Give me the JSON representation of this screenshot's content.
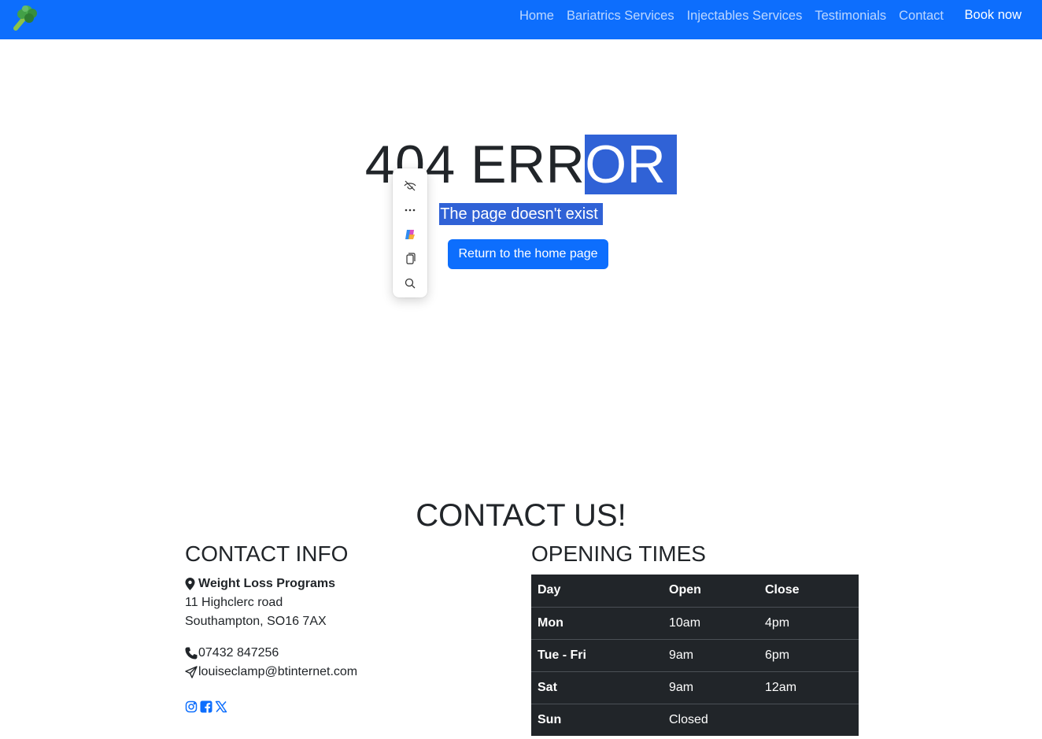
{
  "nav": {
    "logo_icon": "broccoli-icon",
    "links": [
      "Home",
      "Bariatrics Services",
      "Injectables Services",
      "Testimonials",
      "Contact"
    ],
    "book_label": "Book now",
    "bg_color": "#0d6efd"
  },
  "error": {
    "title_plain": "404 ERR",
    "title_selected": "OR",
    "subtitle": "The page doesn't exist",
    "home_button": "Return to the home page",
    "selection_color": "#3062d6"
  },
  "float_toolbar": {
    "icons": [
      "hide-icon",
      "more-icon",
      "copilot-icon",
      "copy-icon",
      "search-icon"
    ]
  },
  "contact": {
    "heading": "CONTACT US!",
    "info_title": "CONTACT INFO",
    "business_name": "Weight Loss Programs",
    "address_line1": "11 Highclerc road",
    "address_line2": "Southampton, SO16 7AX",
    "phone": "07432 847256",
    "email": "louiseclamp@btinternet.com",
    "social_icons": [
      "instagram-icon",
      "facebook-icon",
      "x-twitter-icon"
    ]
  },
  "hours": {
    "title": "OPENING TIMES",
    "headers": [
      "Day",
      "Open",
      "Close"
    ],
    "rows": [
      [
        "Mon",
        "10am",
        "4pm"
      ],
      [
        "Tue - Fri",
        "9am",
        "6pm"
      ],
      [
        "Sat",
        "9am",
        "12am"
      ],
      [
        "Sun",
        "Closed",
        ""
      ]
    ]
  }
}
